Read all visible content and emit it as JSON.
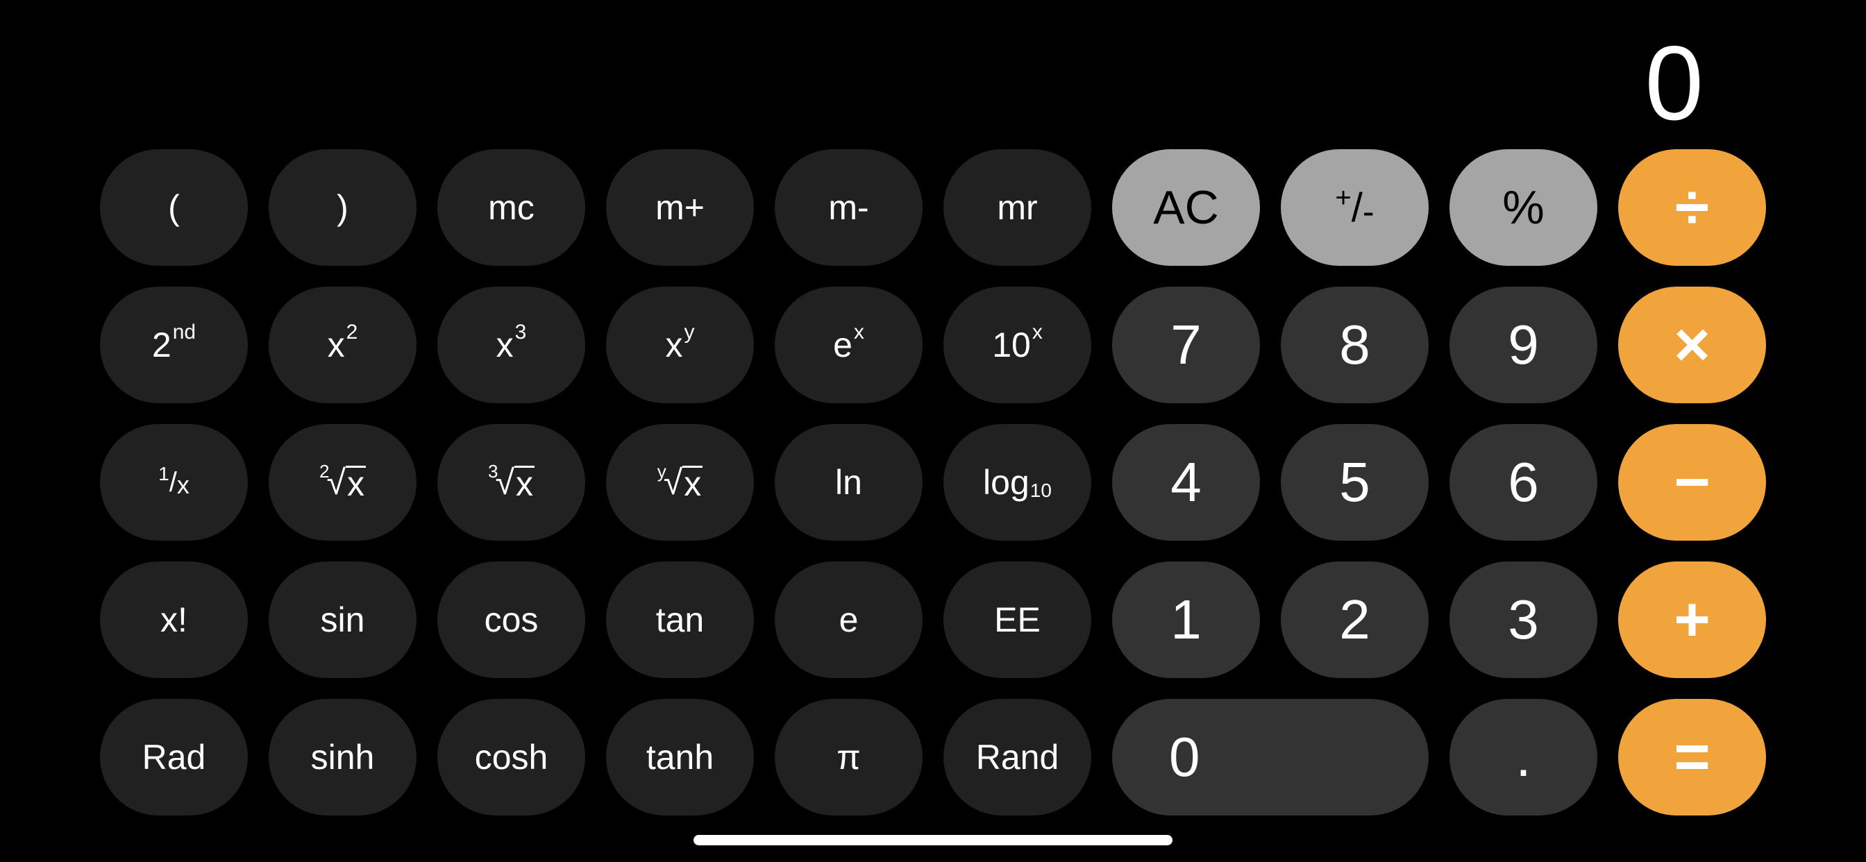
{
  "app": "Calculator",
  "mode": "Scientific",
  "display": {
    "value": "0"
  },
  "colors": {
    "background": "#000000",
    "scientific_key": "#212121",
    "number_key": "#333333",
    "function_key": "#a5a5a5",
    "operator_key": "#f1a33c",
    "text": "#ffffff"
  },
  "keys": {
    "open_paren": "(",
    "close_paren": ")",
    "mc": "mc",
    "m_plus": "m+",
    "m_minus": "m-",
    "mr": "mr",
    "ac": "AC",
    "plus_minus": {
      "plus": "+",
      "slash": "/",
      "minus": "-"
    },
    "percent": "%",
    "divide": "÷",
    "second": {
      "base": "2",
      "sup": "nd"
    },
    "x_squared": {
      "base": "x",
      "sup": "2"
    },
    "x_cubed": {
      "base": "x",
      "sup": "3"
    },
    "x_pow_y": {
      "base": "x",
      "sup": "y"
    },
    "e_pow_x": {
      "base": "e",
      "sup": "x"
    },
    "ten_pow_x": {
      "base": "10",
      "sup": "x"
    },
    "seven": "7",
    "eight": "8",
    "nine": "9",
    "multiply": "×",
    "reciprocal": {
      "num": "1",
      "slash": "/",
      "den": "x"
    },
    "square_root": {
      "index": "2",
      "radical": "√",
      "radicand": "x"
    },
    "cube_root": {
      "index": "3",
      "radical": "√",
      "radicand": "x"
    },
    "y_root": {
      "index": "y",
      "radical": "√",
      "radicand": "x"
    },
    "ln": "ln",
    "log10": {
      "base": "log",
      "sub": "10"
    },
    "four": "4",
    "five": "5",
    "six": "6",
    "minus": "−",
    "factorial": "x!",
    "sin": "sin",
    "cos": "cos",
    "tan": "tan",
    "e": "e",
    "ee": "EE",
    "one": "1",
    "two": "2",
    "three": "3",
    "plus": "+",
    "rad": "Rad",
    "sinh": "sinh",
    "cosh": "cosh",
    "tanh": "tanh",
    "pi": "π",
    "rand": "Rand",
    "zero": "0",
    "decimal": ".",
    "equals": "="
  }
}
